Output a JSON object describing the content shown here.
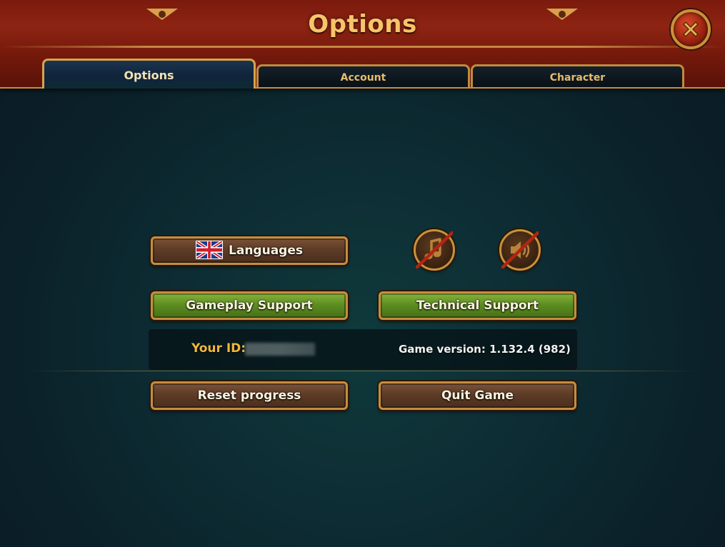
{
  "header": {
    "title": "Options"
  },
  "tabs": [
    {
      "label": "Options",
      "active": true
    },
    {
      "label": "Account",
      "active": false
    },
    {
      "label": "Character",
      "active": false
    }
  ],
  "buttons": {
    "languages": {
      "label": "Languages",
      "icon": "uk-flag-icon"
    },
    "gameplay_support": {
      "label": "Gameplay Support"
    },
    "technical_support": {
      "label": "Technical Support"
    },
    "reset_progress": {
      "label": "Reset progress"
    },
    "quit_game": {
      "label": "Quit Game"
    }
  },
  "toggles": {
    "music": {
      "icon": "music-note-icon",
      "state": "off"
    },
    "sound": {
      "icon": "speaker-icon",
      "state": "off"
    }
  },
  "info": {
    "your_id_label": "Your ID:",
    "game_version": "Game version: 1.132.4 (982)"
  },
  "colors": {
    "header_red": "#8e2413",
    "gold": "#c8923c",
    "title_gold": "#f6c56a",
    "id_label": "#f2b63a",
    "button_green": "#5e8e22",
    "button_brown": "#5e3c27",
    "background_teal": "#0d2c33"
  }
}
